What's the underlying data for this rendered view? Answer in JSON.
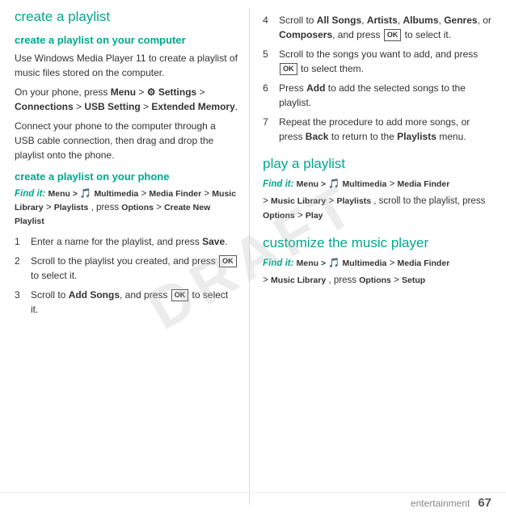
{
  "page": {
    "draft_watermark": "DRAFT",
    "footer": {
      "section_label": "entertainment",
      "page_number": "67"
    }
  },
  "left_column": {
    "main_title": "create a playlist",
    "computer_section": {
      "title": "create a playlist on your computer",
      "body1": "Use Windows Media Player 11 to create a playlist of music files stored on the computer.",
      "body2_prefix": "On your phone, press ",
      "body2_menu": "Menu",
      "body2_mid": " > ",
      "body2_settings": "Settings",
      "body2_gt1": " > ",
      "body2_conn": "Connections",
      "body2_gt2": " > ",
      "body2_usb": "USB Setting",
      "body2_gt3": " > ",
      "body2_ext": "Extended Memory",
      "body2_end": ".",
      "body3": "Connect your phone to the computer through a USB cable connection, then drag and drop the playlist onto the phone."
    },
    "phone_section": {
      "title": "create a playlist on your phone",
      "find_it_label": "Find it:",
      "find_path": "Menu > ",
      "find_multimedia": "Multimedia",
      "find_gt1": " > ",
      "find_media_finder": "Media Finder",
      "find_gt2": " > ",
      "find_music_lib": "Music Library",
      "find_gt3": " > ",
      "find_playlists": "Playlists",
      "find_options": ", press ",
      "find_options_bold": "Options",
      "find_gt4": " > ",
      "find_create": "Create New Playlist",
      "steps": [
        {
          "num": "1",
          "text_prefix": "Enter a name for the playlist, and press ",
          "text_bold": "Save",
          "text_suffix": "."
        },
        {
          "num": "2",
          "text_prefix": "Scroll to the playlist you created, and press ",
          "text_ok": "OK",
          "text_suffix": " to select it."
        },
        {
          "num": "3",
          "text_prefix": "Scroll to ",
          "text_bold": "Add Songs",
          "text_mid": ", and press ",
          "text_ok": "OK",
          "text_suffix": " to select it."
        }
      ]
    }
  },
  "right_column": {
    "step4": {
      "num": "4",
      "text_prefix": "Scroll to ",
      "text_bold1": "All Songs",
      "text_sep1": ", ",
      "text_bold2": "Artists",
      "text_sep2": ", ",
      "text_bold3": "Albums",
      "text_sep3": ", ",
      "text_bold4": "Genres",
      "text_sep4": ", or ",
      "text_bold5": "Composers",
      "text_mid": ", and press ",
      "text_ok": "OK",
      "text_suffix": " to select it."
    },
    "step5": {
      "num": "5",
      "text_prefix": "Scroll to the songs you want to add, and press ",
      "text_ok": "OK",
      "text_suffix": " to select them."
    },
    "step6": {
      "num": "6",
      "text_prefix": "Press ",
      "text_bold": "Add",
      "text_suffix": " to add the selected songs to the playlist."
    },
    "step7": {
      "num": "7",
      "text_prefix": "Repeat the procedure to add more songs, or press ",
      "text_bold1": "Back",
      "text_mid": " to return to the ",
      "text_bold2": "Playlists",
      "text_suffix": " menu."
    },
    "play_section": {
      "title": "play a playlist",
      "find_it_label": "Find it:",
      "find_path": "Menu > ",
      "find_multimedia": "Multimedia",
      "find_gt1": " > ",
      "find_media_finder": "Media Finder",
      "find_gt2": " > ",
      "find_music_lib": "Music Library",
      "find_gt3": " > ",
      "find_playlists": "Playlists",
      "find_scroll": ", scroll to the playlist, press ",
      "find_options": "Options",
      "find_gt4": " > ",
      "find_play": "Play"
    },
    "customize_section": {
      "title": "customize the music player",
      "find_it_label": "Find it:",
      "find_path": "Menu > ",
      "find_multimedia": "Multimedia",
      "find_gt1": " > ",
      "find_media_finder": "Media Finder",
      "find_gt2": " > ",
      "find_music_lib": "Music Library",
      "find_sep": ", press ",
      "find_options": "Options",
      "find_gt3": " > ",
      "find_setup": "Setup"
    }
  }
}
